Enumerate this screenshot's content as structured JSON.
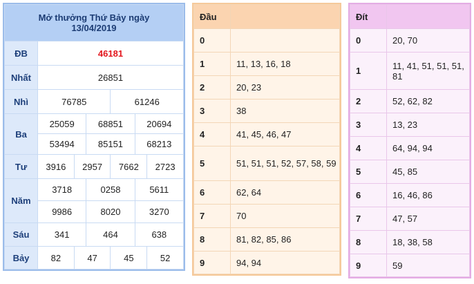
{
  "results": {
    "title_line1": "Mở thưởng Thứ Bảy ngày",
    "title_line2": "13/04/2019",
    "prizes": {
      "db": {
        "label": "ĐB",
        "values": [
          "46181"
        ]
      },
      "nhat": {
        "label": "Nhất",
        "values": [
          "26851"
        ]
      },
      "nhi": {
        "label": "Nhì",
        "values": [
          "76785",
          "61246"
        ]
      },
      "ba": {
        "label": "Ba",
        "values": [
          "25059",
          "68851",
          "20694",
          "53494",
          "85151",
          "68213"
        ]
      },
      "tu": {
        "label": "Tư",
        "values": [
          "3916",
          "2957",
          "7662",
          "2723"
        ]
      },
      "nam": {
        "label": "Năm",
        "values": [
          "3718",
          "0258",
          "5611",
          "9986",
          "8020",
          "3270"
        ]
      },
      "sau": {
        "label": "Sáu",
        "values": [
          "341",
          "464",
          "638"
        ]
      },
      "bay": {
        "label": "Bảy",
        "values": [
          "82",
          "47",
          "45",
          "52"
        ]
      }
    }
  },
  "heads": {
    "header": "Đầu",
    "rows": [
      {
        "digit": "0",
        "values": ""
      },
      {
        "digit": "1",
        "values": "11, 13, 16, 18"
      },
      {
        "digit": "2",
        "values": "20, 23"
      },
      {
        "digit": "3",
        "values": "38"
      },
      {
        "digit": "4",
        "values": "41, 45, 46, 47"
      },
      {
        "digit": "5",
        "values": "51, 51, 51, 52, 57, 58, 59"
      },
      {
        "digit": "6",
        "values": "62, 64"
      },
      {
        "digit": "7",
        "values": "70"
      },
      {
        "digit": "8",
        "values": "81, 82, 85, 86"
      },
      {
        "digit": "9",
        "values": "94, 94"
      }
    ]
  },
  "tails": {
    "header": "Đít",
    "rows": [
      {
        "digit": "0",
        "values": "20, 70"
      },
      {
        "digit": "1",
        "values": "11, 41, 51, 51, 51, 81"
      },
      {
        "digit": "2",
        "values": "52, 62, 82"
      },
      {
        "digit": "3",
        "values": "13, 23"
      },
      {
        "digit": "4",
        "values": "64, 94, 94"
      },
      {
        "digit": "5",
        "values": "45, 85"
      },
      {
        "digit": "6",
        "values": "16, 46, 86"
      },
      {
        "digit": "7",
        "values": "47, 57"
      },
      {
        "digit": "8",
        "values": "18, 38, 58"
      },
      {
        "digit": "9",
        "values": "59"
      }
    ]
  },
  "colors": {
    "special_prize": "#e3161d",
    "results_header": "#b4cff4",
    "heads_header": "#fbd4b0",
    "tails_header": "#f1c6f0"
  }
}
